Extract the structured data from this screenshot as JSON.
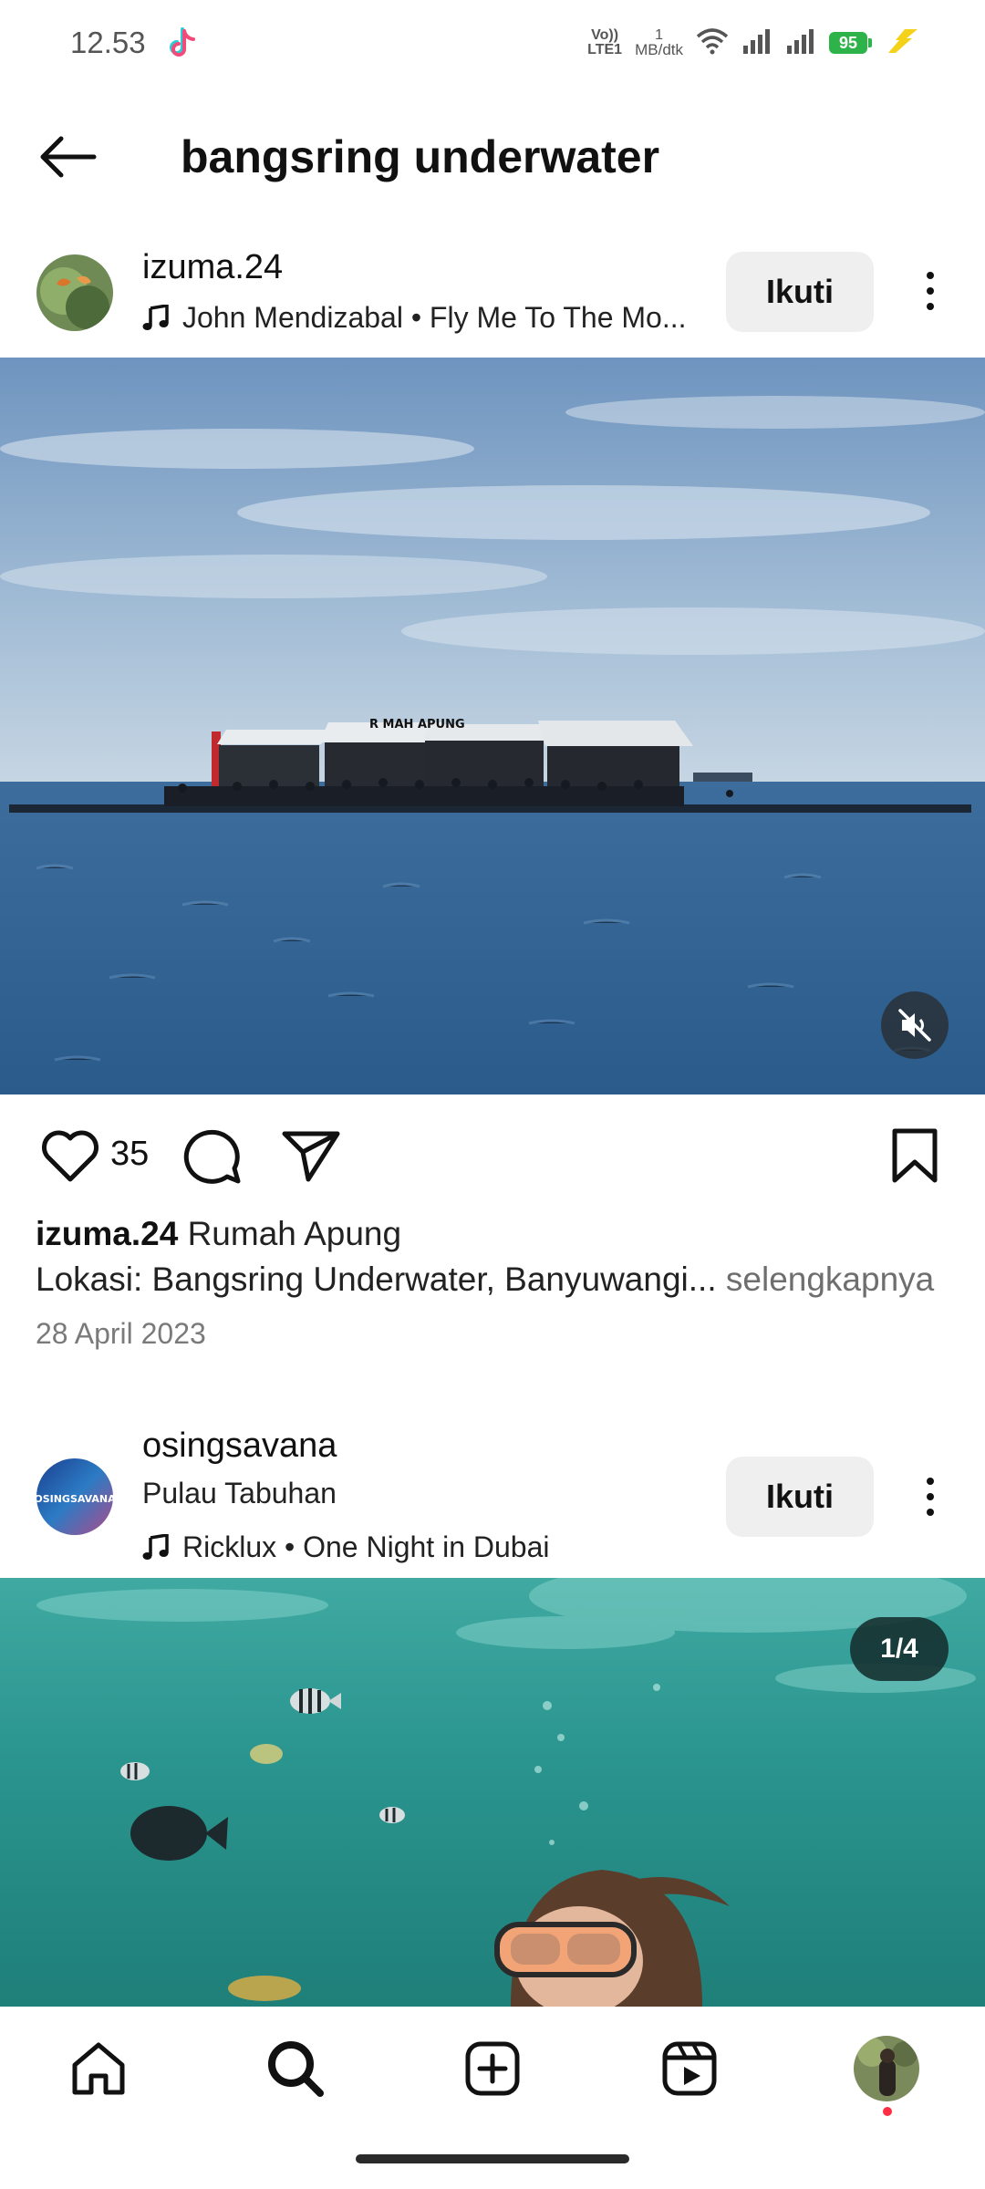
{
  "status_bar": {
    "time": "12.53",
    "volte_label": "Vo)) LTE1",
    "data_speed_value": "1",
    "data_speed_unit": "MB/dtk",
    "battery_level": "95",
    "battery_color": "#2db34a"
  },
  "header": {
    "title": "bangsring underwater",
    "back_icon": "arrow-left-icon"
  },
  "posts": [
    {
      "username": "izuma.24",
      "music": "John Mendizabal • Fly Me To The Mo...",
      "follow_label": "Ikuti",
      "likes": "35",
      "caption_user": "izuma.24",
      "caption_text": "Rumah Apung",
      "caption_line2": "Lokasi: Bangsring Underwater, Banyuwangi...",
      "caption_more": "selengkapnya",
      "date": "28 April 2023",
      "sign_text": "R MAH   APUNG"
    },
    {
      "username": "osingsavana",
      "location": "Pulau Tabuhan",
      "music": "Ricklux • One Night in Dubai",
      "follow_label": "Ikuti",
      "page_counter": "1/4",
      "avatar_text": "OSINGSAVANA"
    }
  ],
  "bottom_nav": {
    "items": [
      "home-icon",
      "search-icon",
      "create-icon",
      "reels-icon",
      "profile-avatar"
    ],
    "active": "search-icon",
    "notification_dot_color": "#ff2e43"
  }
}
